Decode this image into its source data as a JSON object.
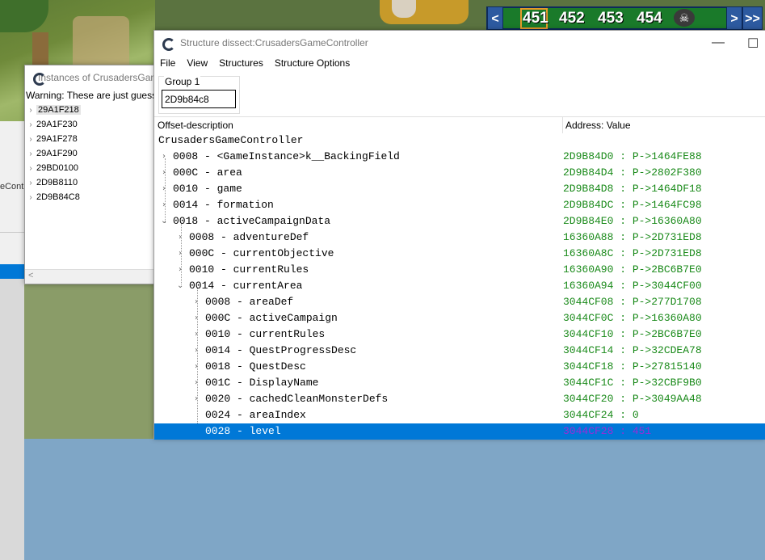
{
  "game": {
    "area_numbers": [
      "451",
      "452",
      "453",
      "454"
    ],
    "nav_prev": "<",
    "nav_next": ">",
    "nav_fast": ">>",
    "skull": "☠"
  },
  "instances_window": {
    "title": "Instances of CrusadersGameController",
    "warning": "Warning: These are just guesses",
    "items": [
      "29A1F218",
      "29A1F230",
      "29A1F278",
      "29A1F290",
      "29BD0100",
      "2D9B8110",
      "2D9B84C8"
    ],
    "scroll_left": "<"
  },
  "structure_window": {
    "title": "Structure dissect:CrusadersGameController",
    "minimize": "—",
    "maximize": "☐",
    "menu": [
      "File",
      "View",
      "Structures",
      "Structure Options"
    ],
    "group_label": "Group 1",
    "address_input": "2D9b84c8",
    "col_offset": "Offset-description",
    "col_address": "Address: Value",
    "root": "CrusadersGameController",
    "rows": [
      {
        "desc": "0008 - <GameInstance>k__BackingField",
        "val": "2D9B84D0 : P->1464FE88"
      },
      {
        "desc": "000C - area",
        "val": "2D9B84D4 : P->2802F380"
      },
      {
        "desc": "0010 - game",
        "val": "2D9B84D8 : P->1464DF18"
      },
      {
        "desc": "0014 - formation",
        "val": "2D9B84DC : P->1464FC98"
      },
      {
        "desc": "0018 - activeCampaignData",
        "val": "2D9B84E0 : P->16360A80"
      },
      {
        "desc": "0008 - adventureDef",
        "val": "16360A88 : P->2D731ED8"
      },
      {
        "desc": "000C - currentObjective",
        "val": "16360A8C : P->2D731ED8"
      },
      {
        "desc": "0010 - currentRules",
        "val": "16360A90 : P->2BC6B7E0"
      },
      {
        "desc": "0014 - currentArea",
        "val": "16360A94 : P->3044CF00"
      },
      {
        "desc": "0008 - areaDef",
        "val": "3044CF08 : P->277D1708"
      },
      {
        "desc": "000C - activeCampaign",
        "val": "3044CF0C : P->16360A80"
      },
      {
        "desc": "0010 - currentRules",
        "val": "3044CF10 : P->2BC6B7E0"
      },
      {
        "desc": "0014 - QuestProgressDesc",
        "val": "3044CF14 : P->32CDEA78"
      },
      {
        "desc": "0018 - QuestDesc",
        "val": "3044CF18 : P->27815140"
      },
      {
        "desc": "001C - DisplayName",
        "val": "3044CF1C : P->32CBF9B0"
      },
      {
        "desc": "0020 - cachedCleanMonsterDefs",
        "val": "3044CF20 : P->3049AA48"
      },
      {
        "desc": "0024 - areaIndex",
        "val": "3044CF24 : 0"
      },
      {
        "desc": "0028 - level",
        "val": "3044CF28 : 451"
      }
    ]
  },
  "background_left_text": "eCont"
}
